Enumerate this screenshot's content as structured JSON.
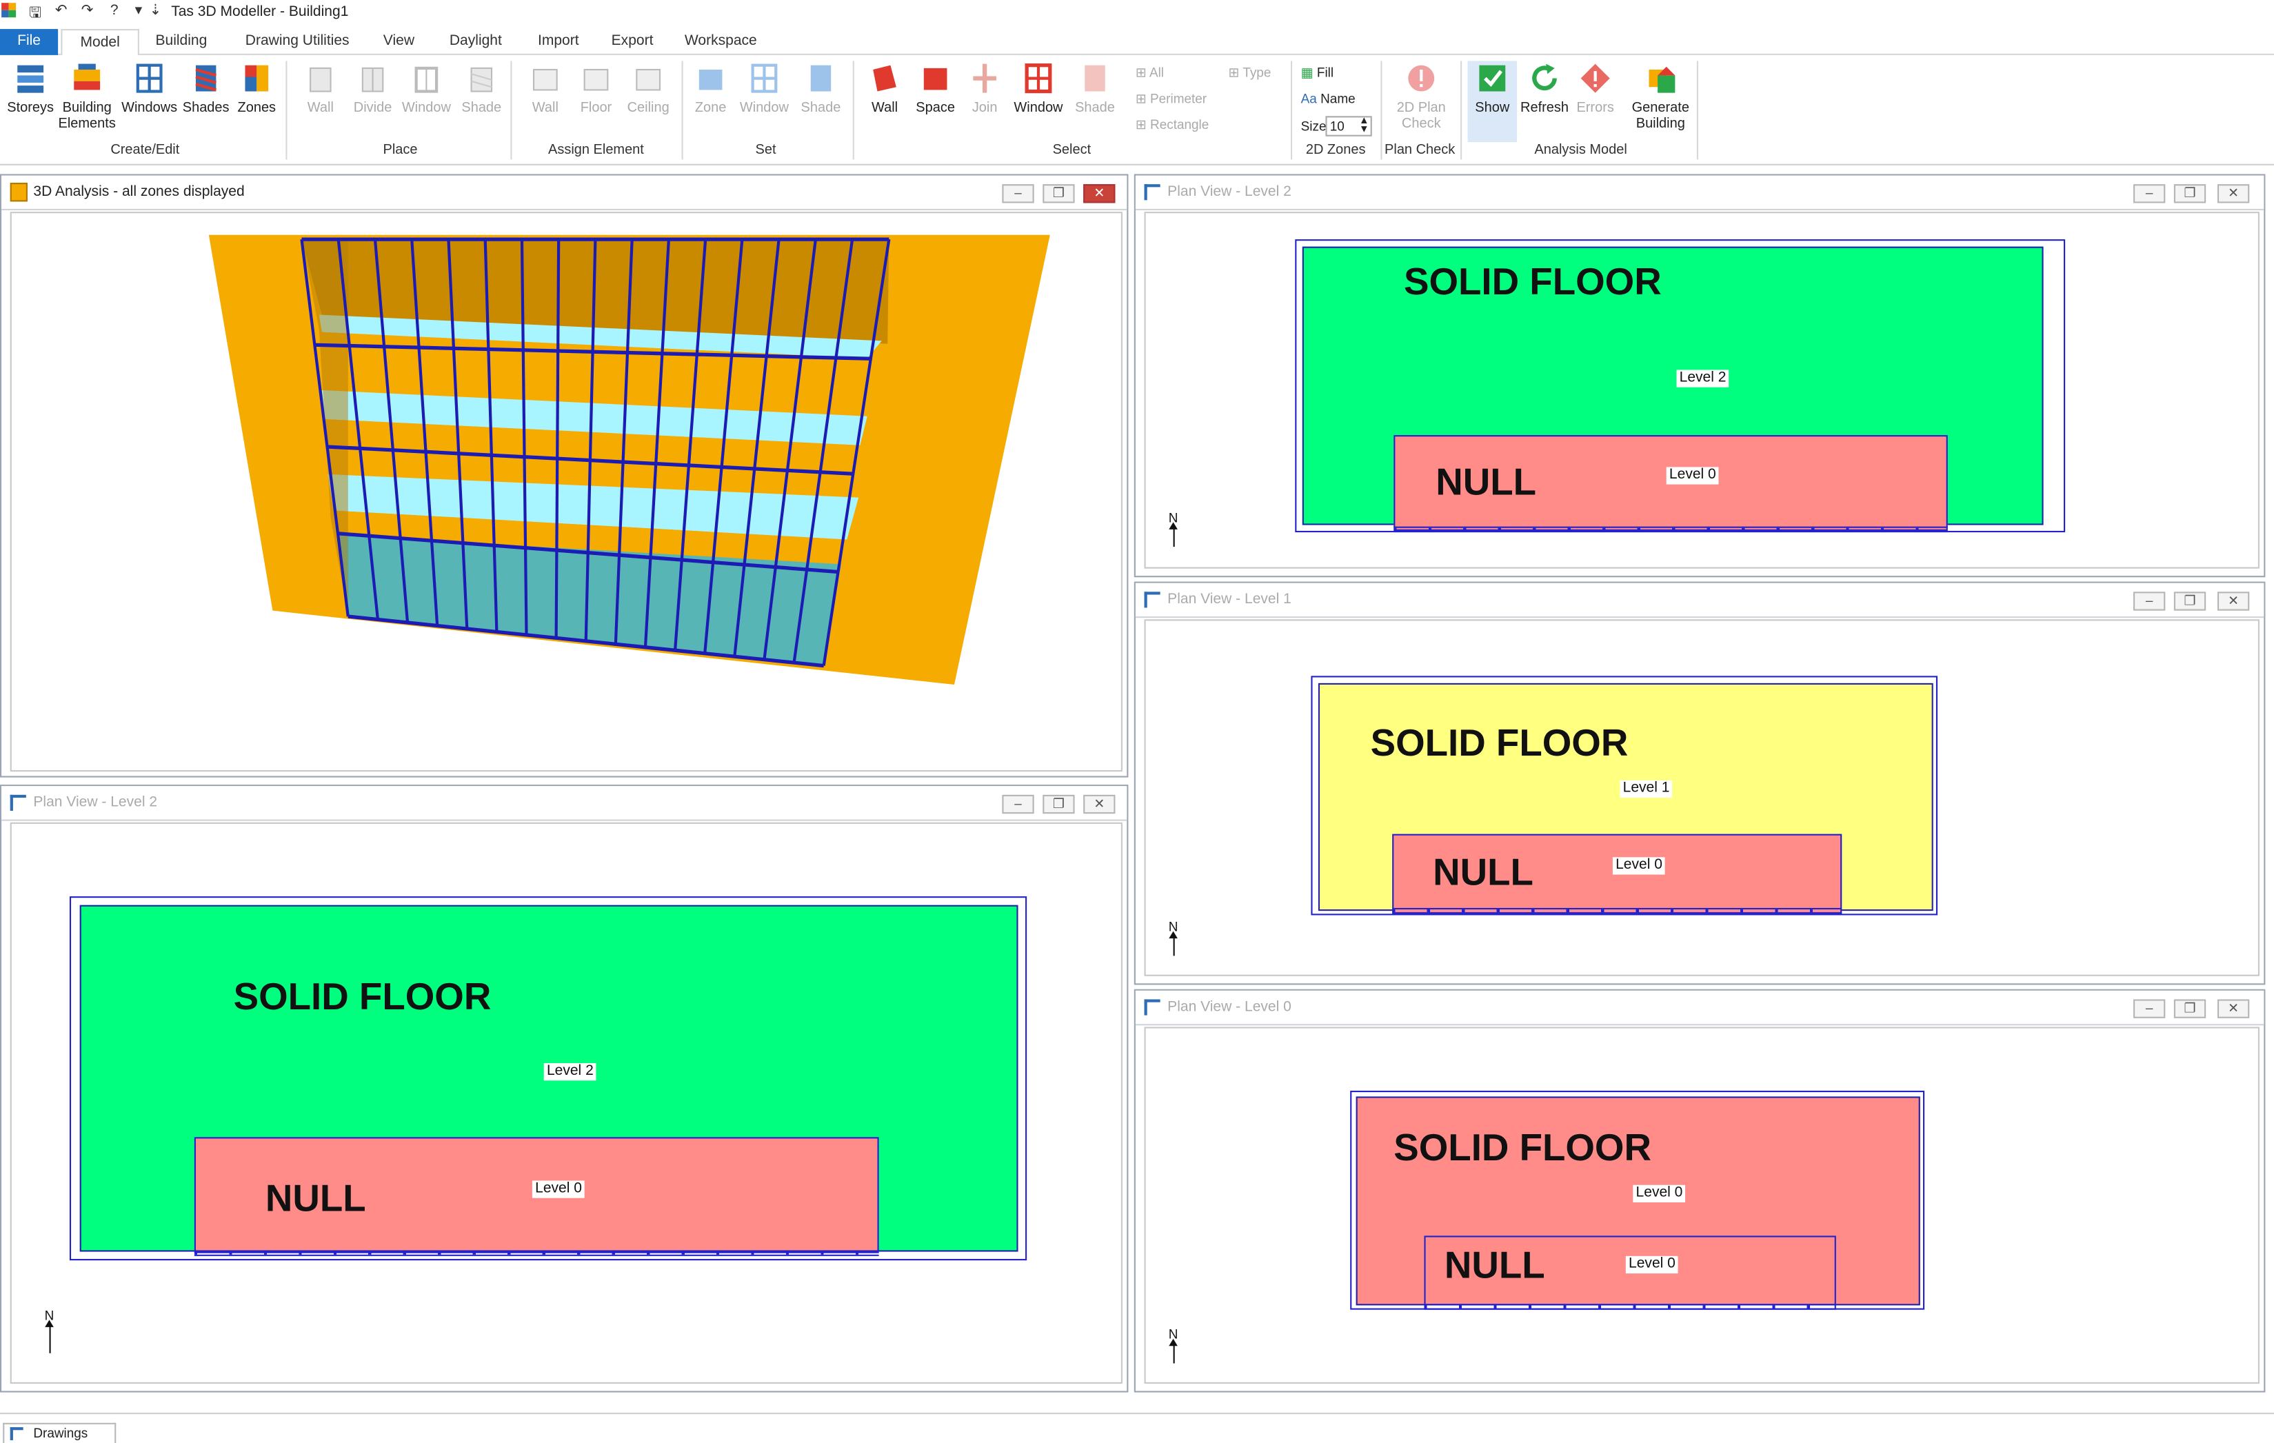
{
  "window": {
    "title": "Tas 3D Modeller - Building1"
  },
  "tabs": [
    "File",
    "Model",
    "Building",
    "Drawing Utilities",
    "View",
    "Daylight",
    "Import",
    "Export",
    "Workspace"
  ],
  "ribbon": {
    "create_edit": {
      "buttons": [
        "Storeys",
        "Building",
        "Windows",
        "Shades",
        "Zones"
      ],
      "building_sub": "Elements",
      "group": "Create/Edit"
    },
    "place": {
      "buttons": [
        "Wall",
        "Divide",
        "Window",
        "Shade"
      ],
      "group": "Place"
    },
    "assign": {
      "buttons": [
        "Wall",
        "Floor",
        "Ceiling"
      ],
      "group": "Assign Element"
    },
    "set": {
      "buttons": [
        "Zone",
        "Window",
        "Shade"
      ],
      "group": "Set"
    },
    "select": {
      "buttons": [
        "Wall",
        "Space",
        "Join",
        "Window",
        "Shade"
      ],
      "small": [
        "All",
        "Perimeter",
        "Rectangle",
        "Type"
      ],
      "group": "Select"
    },
    "zones2d": {
      "fill": "Fill",
      "name": "Name",
      "size_label": "Size",
      "size_value": "10",
      "group": "2D Zones"
    },
    "plancheck": {
      "line1": "2D Plan",
      "line2": "Check",
      "group": "Plan Check"
    },
    "analysis": {
      "buttons": [
        "Show",
        "Refresh",
        "Errors"
      ],
      "generate1": "Generate",
      "generate2": "Building",
      "group": "Analysis Model"
    }
  },
  "panels": {
    "analysis3d": {
      "title": "3D Analysis - all zones displayed"
    },
    "plan_tr": {
      "title": "Plan View - Level 2",
      "solid": "SOLID FLOOR",
      "solid_level": "Level 2",
      "null": "NULL",
      "null_level": "Level 0",
      "north": "N"
    },
    "plan_mr": {
      "title": "Plan View - Level 1",
      "solid": "SOLID FLOOR",
      "solid_level": "Level 1",
      "null": "NULL",
      "null_level": "Level 0",
      "north": "N"
    },
    "plan_br": {
      "title": "Plan View - Level 0",
      "solid": "SOLID FLOOR",
      "solid_level": "Level 0",
      "null": "NULL",
      "null_level": "Level 0",
      "north": "N"
    },
    "plan_bl": {
      "title": "Plan View - Level 2",
      "solid": "SOLID FLOOR",
      "solid_level": "Level 2",
      "null": "NULL",
      "null_level": "Level 0",
      "north": "N"
    }
  },
  "window_buttons": {
    "minimize": "–",
    "restore": "❐",
    "close": "✕"
  },
  "statusbar": {
    "drawings_tab": "Drawings"
  },
  "colors": {
    "green": "#00ff7f",
    "yellow": "#ffff80",
    "salmon": "#ff8c88",
    "orange": "#f5ab00",
    "cyan": "#a8f4ff",
    "blue": "#1c1cb4",
    "accent": "#1e73c8"
  }
}
